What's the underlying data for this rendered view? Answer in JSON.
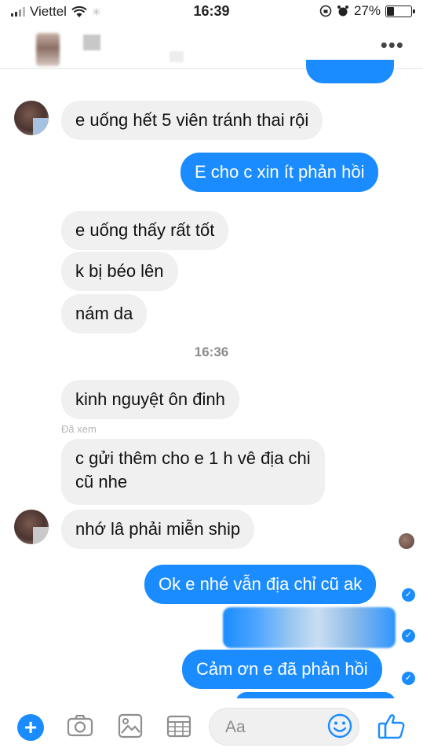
{
  "status": {
    "carrier": "Viettel",
    "time": "16:39",
    "battery": "27%",
    "battery_level": 0.27
  },
  "header": {
    "more": "•••"
  },
  "messages": {
    "m1": "e uống hết 5 viên tránh thai rội",
    "m2": "E cho c xin ít phản hồi",
    "m3": "e uống thấy rất tốt",
    "m4": "k bị béo lên",
    "m5": "nám da",
    "time_divider": "16:36",
    "m6": "kinh nguyệt ôn đinh",
    "seen_label": "Đã xem",
    "m7_line1": "c gửi thêm cho e 1 h vê địa chi",
    "m7_line2": "cũ nhe",
    "m8": "nhớ lâ phải miễn ship",
    "m9": "Ok e nhé vẫn địa chỉ cũ ak",
    "m11": "Cảm ơn e đã phản hồi"
  },
  "composer": {
    "placeholder": "Aa"
  },
  "colors": {
    "accent": "#1a8cff",
    "incoming_bubble": "#f1f0f0"
  },
  "icons": [
    "plus-icon",
    "camera-icon",
    "gallery-icon",
    "sticker-icon",
    "emoji-icon",
    "thumbs-up-icon"
  ]
}
